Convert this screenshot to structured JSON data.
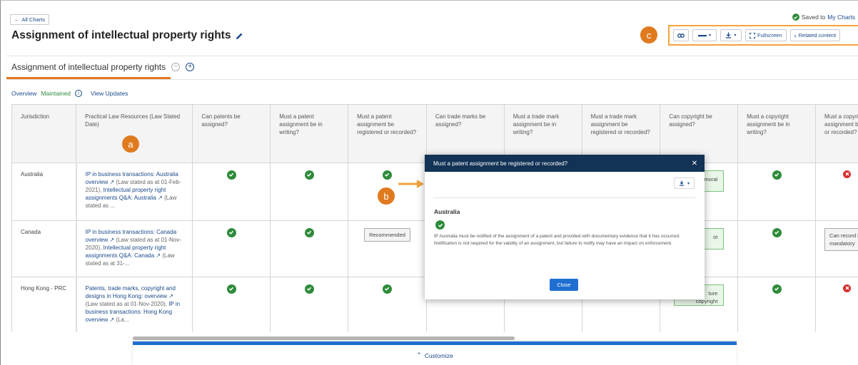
{
  "header": {
    "back_label": "All Charts",
    "title": "Assignment of intellectual property rights",
    "saved_prefix": "Saved to",
    "saved_link": "My Charts"
  },
  "toolbar": {
    "fullscreen_label": "Fullscreen",
    "related_label": "Related content",
    "icons": [
      "link-icon",
      "line-style-icon",
      "download-icon",
      "fullscreen-icon",
      "chevron-left-icon"
    ]
  },
  "annotations": {
    "a": "a",
    "b": "b",
    "c": "c"
  },
  "tab": {
    "label": "Assignment of intellectual property rights"
  },
  "subnav": {
    "overview": "Overview",
    "maintained": "Maintained",
    "view_updates": "View Updates"
  },
  "table": {
    "headers": [
      "Jurisdiction",
      "Practical Law Resources (Law Stated Date)",
      "Can patents be assigned?",
      "Must a patent assignment be in writing?",
      "Must a patent assignment be registered or recorded?",
      "Can trade marks be assigned?",
      "Must a trade mark assignment be in writing?",
      "Must a trade mark assignment be registered or recorded?",
      "Can copyright be assigned?",
      "Must a copyright assignment be in writing?",
      "Must a copyri assignment b registered or recorded?"
    ],
    "rows": [
      {
        "jurisdiction": "Australia",
        "resource": "IP in business transactions: Australia overview",
        "resource_meta": "(Law stated as at 01-Feb-2021),",
        "resource2": "Intellectual property right assignments Q&A: Australia",
        "resource_tail": "(Law stated as ...",
        "copyright_tag": "moral"
      },
      {
        "jurisdiction": "Canada",
        "resource": "IP in business transactions: Canada overview",
        "resource_meta": "(Law stated as at 01-Nov-2020),",
        "resource2": "Intellectual property right assignments Q&A: Canada",
        "resource_tail": "(Law stated as at 31-...",
        "patent_registered_tag": "Recommended",
        "copyright_tag": "ot",
        "copyright_registered_tag": "Can record bu mandatory"
      },
      {
        "jurisdiction": "Hong Kong - PRC",
        "resource": "Patents, trade marks, copyright and designs in Hong Kong: overview",
        "resource_meta": "(Law stated as at 01-Nov-2020),",
        "resource2": "IP in business transactions: Hong Kong overview",
        "resource_tail": "(La...",
        "copyright_tag": "ture",
        "copyright_tag_bottom": "copyright"
      }
    ]
  },
  "modal": {
    "title": "Must a patent assignment be registered or recorded?",
    "jurisdiction": "Australia",
    "text": "IP Australia must be notified of the assignment of a patent and provided with documentary evidence that it has occurred. Notification is not required for the validity of an assignment, but failure to notify may have an impact on enforcement.",
    "close_label": "Close"
  },
  "footer": {
    "customize_label": "Customize"
  },
  "colors": {
    "accent_orange": "#e07a1f",
    "navy": "#123256",
    "brand_blue": "#1f6fd1",
    "success": "#2e8b3a",
    "danger": "#d32f2f"
  }
}
